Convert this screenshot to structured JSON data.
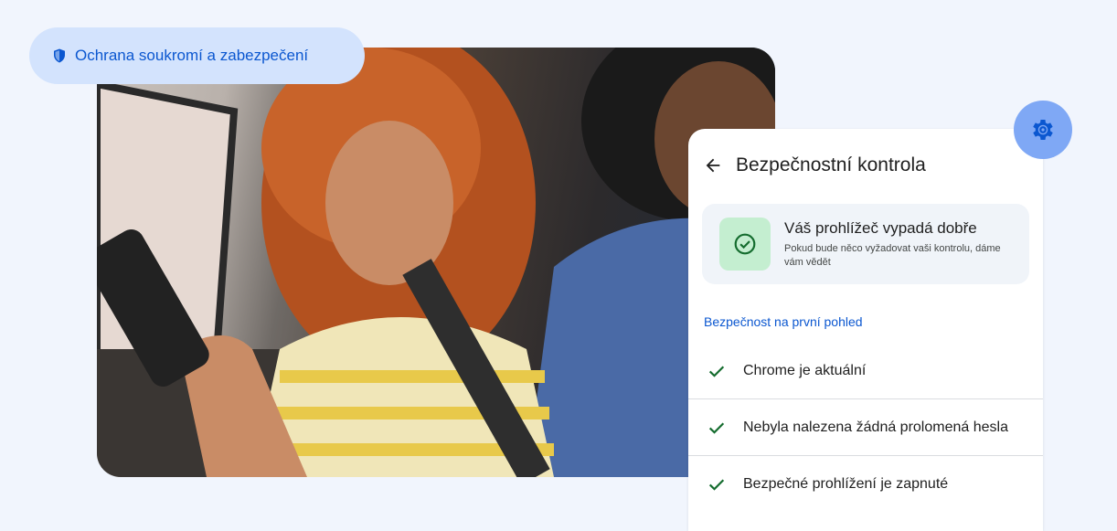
{
  "badge": {
    "label": "Ochrana soukromí a zabezpečení",
    "icon": "shield-icon"
  },
  "panel": {
    "title": "Bezpečnostní kontrola",
    "back_icon": "arrow-back-icon",
    "status": {
      "title": "Váš prohlížeč vypadá dobře",
      "description": "Pokud bude něco vyžadovat vaši kontrolu, dáme vám vědět",
      "icon": "check-circle-icon"
    },
    "section_heading": "Bezpečnost na první pohled",
    "items": [
      {
        "label": "Chrome je aktuální",
        "icon": "check-icon"
      },
      {
        "label": "Nebyla nalezena žádná prolomená hesla",
        "icon": "check-icon"
      },
      {
        "label": "Bezpečné prohlížení je zapnuté",
        "icon": "check-icon"
      }
    ]
  },
  "settings_button": {
    "icon": "gear-icon"
  },
  "colors": {
    "background": "#f1f5fd",
    "accent_blue": "#0b57d0",
    "pill_bg": "#d3e3fd",
    "success_green": "#146c2e",
    "success_bg": "#c4eed0"
  }
}
